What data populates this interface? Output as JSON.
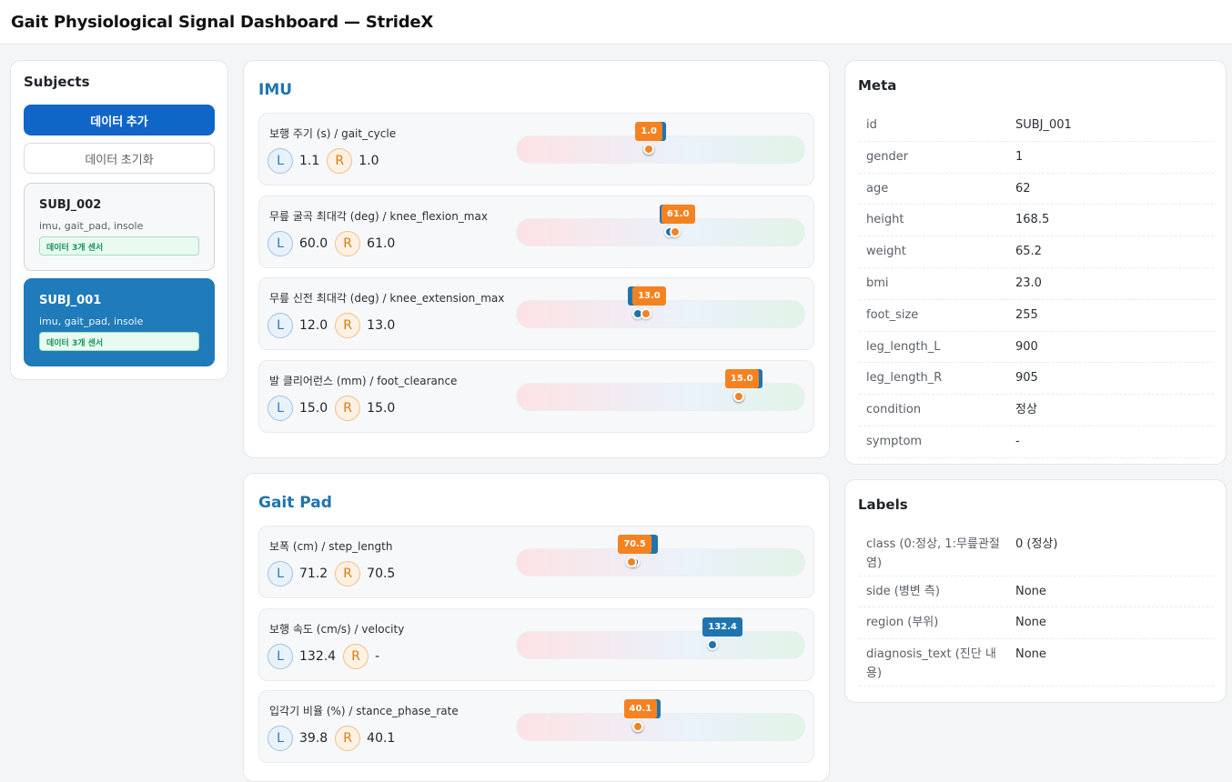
{
  "app": {
    "title": "Gait Physiological Signal Dashboard — StrideX"
  },
  "subjects": {
    "title": "Subjects",
    "add_button": "데이터 추가",
    "reset_button": "데이터 초기화",
    "items": [
      {
        "id": "SUBJ_002",
        "sensors": "imu, gait_pad, insole",
        "badge": "데이터 3개 센서",
        "active": false
      },
      {
        "id": "SUBJ_001",
        "sensors": "imu, gait_pad, insole",
        "badge": "데이터 3개 센서",
        "active": true
      }
    ]
  },
  "imu": {
    "title": "IMU",
    "metrics": [
      {
        "label": "보행 주기 (s) / gait_cycle",
        "L": "1.1",
        "R": "1.0",
        "L_text": "1.1",
        "R_text": "1.0",
        "L_pos": 0.46,
        "R_pos": 0.46
      },
      {
        "label": "무릎 굴곡 최대각 (deg) / knee_flexion_max",
        "L": "60.0",
        "R": "61.0",
        "L_text": "60.0",
        "R_text": "61.0",
        "L_pos": 0.53,
        "R_pos": 0.55
      },
      {
        "label": "무릎 신전 최대각 (deg) / knee_extension_max",
        "L": "12.0",
        "R": "13.0",
        "L_text": "12.0",
        "R_text": "13.0",
        "L_pos": 0.42,
        "R_pos": 0.45
      },
      {
        "label": "발 클리어런스 (mm) / foot_clearance",
        "L": "15.0",
        "R": "15.0",
        "L_text": "15.0",
        "R_text": "15.0",
        "L_pos": 0.77,
        "R_pos": 0.77
      }
    ]
  },
  "gaitpad": {
    "title": "Gait Pad",
    "metrics": [
      {
        "label": "보폭 (cm) / step_length",
        "L": "71.2",
        "R": "70.5",
        "L_text": "71.2",
        "R_text": "70.5",
        "L_pos": 0.41,
        "R_pos": 0.4
      },
      {
        "label": "보행 속도 (cm/s) / velocity",
        "L": "132.4",
        "R": "-",
        "L_text": "132.4",
        "R_text": null,
        "L_pos": 0.68,
        "R_pos": null
      },
      {
        "label": "입각기 비율 (%) / stance_phase_rate",
        "L": "39.8",
        "R": "40.1",
        "L_text": "39.8",
        "R_text": "40.1",
        "L_pos": 0.42,
        "R_pos": 0.42
      }
    ]
  },
  "meta": {
    "title": "Meta",
    "rows": [
      {
        "k": "id",
        "v": "SUBJ_001"
      },
      {
        "k": "gender",
        "v": "1"
      },
      {
        "k": "age",
        "v": "62"
      },
      {
        "k": "height",
        "v": "168.5"
      },
      {
        "k": "weight",
        "v": "65.2"
      },
      {
        "k": "bmi",
        "v": "23.0"
      },
      {
        "k": "foot_size",
        "v": "255"
      },
      {
        "k": "leg_length_L",
        "v": "900"
      },
      {
        "k": "leg_length_R",
        "v": "905"
      },
      {
        "k": "condition",
        "v": "정상"
      },
      {
        "k": "symptom",
        "v": "-"
      }
    ]
  },
  "labels": {
    "title": "Labels",
    "rows": [
      {
        "k": "class (0:정상, 1:무릎관절염)",
        "v": "0 (정상)"
      },
      {
        "k": "side (병변 측)",
        "v": "None"
      },
      {
        "k": "region (부위)",
        "v": "None"
      },
      {
        "k": "diagnosis_text (진단 내용)",
        "v": "None"
      }
    ]
  },
  "colors": {
    "left": "#1f74b0",
    "right": "#f58220",
    "primary": "#0f66c6",
    "section": "#1f74b0"
  }
}
